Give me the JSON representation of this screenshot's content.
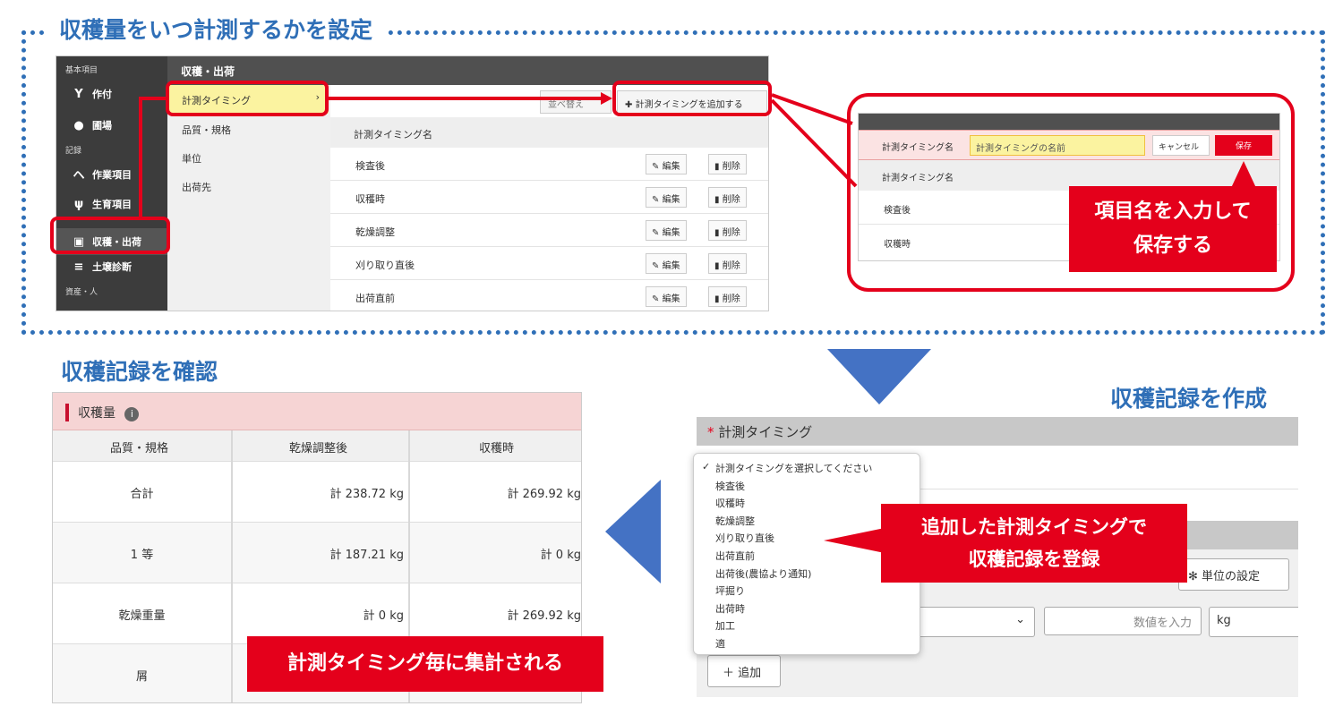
{
  "section1": {
    "title": "収穫量をいつ計測するかを設定",
    "sidebar": {
      "group1": "基本項目",
      "items1": [
        "作付",
        "圃場"
      ],
      "group2": "記録",
      "items2": [
        "作業項目",
        "生育項目",
        "収穫・出荷",
        "土壌診断"
      ],
      "group3": "資産・人"
    },
    "topbar_title": "収穫・出荷",
    "submenu": [
      "計測タイミング",
      "品質・規格",
      "単位",
      "出荷先"
    ],
    "add_button": "計測タイミングを追加する",
    "ghost_button": "並べ替え",
    "column_header": "計測タイミング名",
    "rows": [
      "検査後",
      "収穫時",
      "乾燥調整",
      "刈り取り直後",
      "出荷直前"
    ],
    "edit_label": "編集",
    "delete_label": "削除",
    "inset": {
      "label": "計測タイミング名",
      "input_placeholder": "計測タイミングの名前",
      "cancel": "キャンセル",
      "save": "保存",
      "header": "計測タイミング名",
      "rows": [
        "検査後",
        "収穫時"
      ]
    },
    "callout": [
      "項目名を入力して",
      "保存する"
    ]
  },
  "section2": {
    "title": "収穫記録を作成",
    "field_label": "計測タイミング",
    "required_mark": "*",
    "dropdown_options": [
      "計測タイミングを選択してください",
      "検査後",
      "収穫時",
      "乾燥調整",
      "刈り取り直後",
      "出荷直前",
      "出荷後(農協より通知)",
      "坪掘り",
      "出荷時",
      "加工",
      "適"
    ],
    "selected_option": "計測タイミングを選択してください",
    "unit_button": "単位の設定",
    "number_placeholder": "数値を入力",
    "unit_value": "kg",
    "add_button": "追加",
    "callout": [
      "追加した計測タイミングで",
      "収穫記録を登録"
    ]
  },
  "section3": {
    "title": "収穫記録を確認",
    "table_title": "収穫量",
    "headers": [
      "品質・規格",
      "乾燥調整後",
      "収穫時"
    ],
    "rows": [
      {
        "name": "合計",
        "v1": "計 238.72 kg",
        "v2": "計 269.92 kg"
      },
      {
        "name": "1 等",
        "v1": "計 187.21 kg",
        "v2": "計 0 kg"
      },
      {
        "name": "乾燥重量",
        "v1": "計 0 kg",
        "v2": "計 269.92 kg"
      },
      {
        "name": "屑",
        "v1": "",
        "v2": ""
      }
    ],
    "callout": "計測タイミング毎に集計される"
  },
  "colors": {
    "accent_blue": "#2f6fb7",
    "callout_red": "#e4001b",
    "arrow_blue": "#4472c4"
  }
}
